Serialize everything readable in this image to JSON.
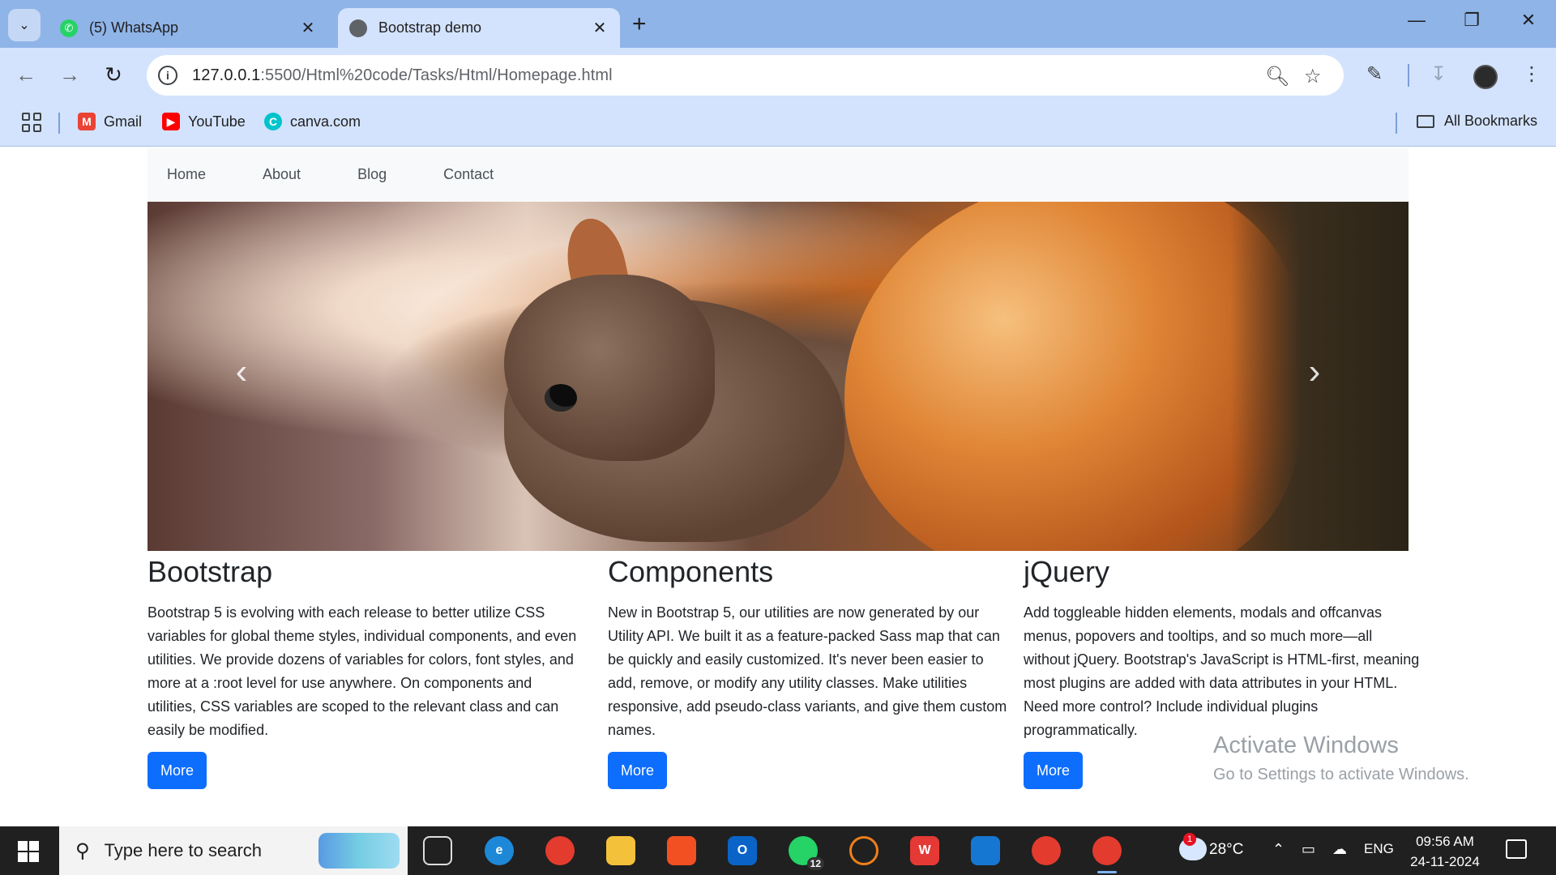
{
  "browser": {
    "tabs": [
      {
        "title": "(5) WhatsApp",
        "icon": "whatsapp-icon",
        "active": false
      },
      {
        "title": "Bootstrap demo",
        "icon": "globe-icon",
        "active": true
      }
    ],
    "new_tab_glyph": "+",
    "url_host": "127.0.0.1",
    "url_path": ":5500/Html%20code/Tasks/Html/Homepage.html",
    "bookmarks": [
      {
        "label": "Gmail",
        "icon": "gmail-icon"
      },
      {
        "label": "YouTube",
        "icon": "youtube-icon"
      },
      {
        "label": "canva.com",
        "icon": "canva-icon"
      }
    ],
    "all_bookmarks": "All Bookmarks",
    "accent": "#8fb4e8",
    "toolbar_color": "#d3e3fd"
  },
  "page": {
    "nav": [
      "Home",
      "About",
      "Blog",
      "Contact"
    ],
    "hero_image": "squirrel-photo",
    "columns": [
      {
        "title": "Bootstrap",
        "text": "Bootstrap 5 is evolving with each release to better utilize CSS variables for global theme styles, individual components, and even utilities. We provide dozens of variables for colors, font styles, and more at a :root level for use anywhere. On components and utilities, CSS variables are scoped to the relevant class and can easily be modified.",
        "button": "More"
      },
      {
        "title": "Components",
        "text": "New in Bootstrap 5, our utilities are now generated by our Utility API. We built it as a feature-packed Sass map that can be quickly and easily customized. It's never been easier to add, remove, or modify any utility classes. Make utilities responsive, add pseudo-class variants, and give them custom names.",
        "button": "More"
      },
      {
        "title": "jQuery",
        "text": "Add toggleable hidden elements, modals and offcanvas menus, popovers and tooltips, and so much more—all without jQuery. Bootstrap's JavaScript is HTML-first, meaning most plugins are added with data attributes in your HTML. Need more control? Include individual plugins programmatically.",
        "button": "More"
      }
    ],
    "button_color": "#0d6efd"
  },
  "watermark": {
    "line1": "Activate Windows",
    "line2": "Go to Settings to activate Windows."
  },
  "taskbar": {
    "search_placeholder": "Type here to search",
    "whatsapp_badge": "12",
    "weather_badge": "1",
    "temperature": "28°C",
    "language": "ENG",
    "time": "09:56 AM",
    "date": "24-11-2024"
  }
}
